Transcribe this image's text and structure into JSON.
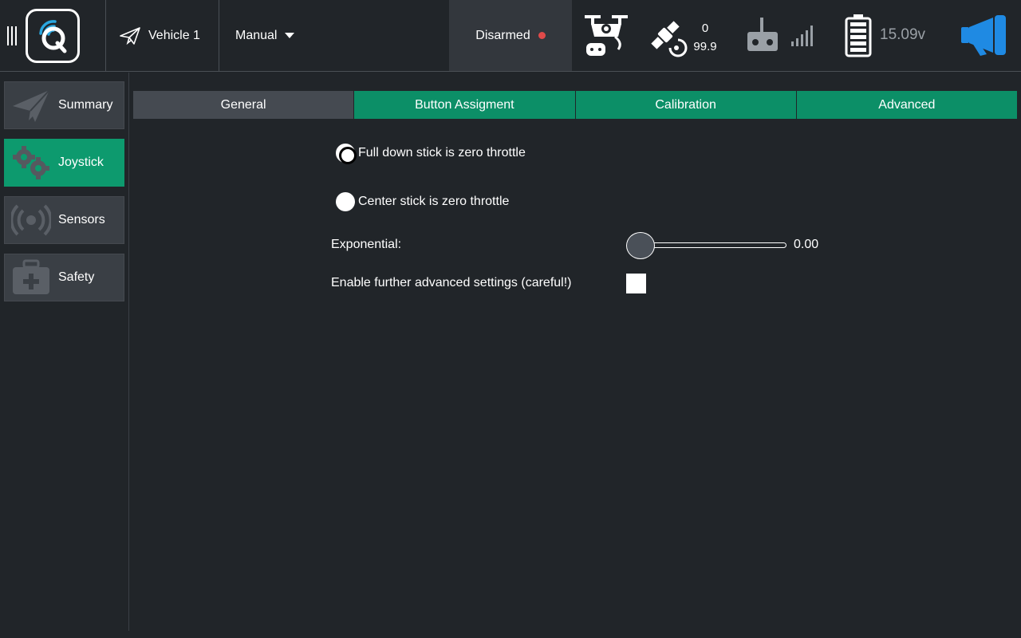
{
  "toolbar": {
    "vehicle_label": "Vehicle 1",
    "flight_mode": "Manual",
    "arm_status": "Disarmed",
    "gps_count": "0",
    "gps_hdop": "99.9",
    "battery_voltage": "15.09v",
    "icons": [
      "menu-handle-icon",
      "qgc-logo-icon",
      "paper-plane-icon",
      "dropdown-arrow-icon",
      "drone-icon",
      "satellite-icon",
      "rc-transmitter-icon",
      "signal-bars-icon",
      "battery-icon",
      "megaphone-icon"
    ],
    "colors": {
      "armed_dot": "#e04a4a",
      "megaphone": "#1f8ae3",
      "logo_accent": "#2aa7e0"
    }
  },
  "nav": {
    "items": [
      {
        "label": "Summary",
        "icon": "paper-plane-icon",
        "active": false
      },
      {
        "label": "Joystick",
        "icon": "gears-icon",
        "active": true
      },
      {
        "label": "Sensors",
        "icon": "sensor-waves-icon",
        "active": false
      },
      {
        "label": "Safety",
        "icon": "first-aid-kit-icon",
        "active": false
      }
    ]
  },
  "tabs": [
    {
      "label": "General",
      "active": true
    },
    {
      "label": "Button Assigment",
      "active": false
    },
    {
      "label": "Calibration",
      "active": false
    },
    {
      "label": "Advanced",
      "active": false
    }
  ],
  "general": {
    "throttle_options": [
      {
        "label": "Full down stick is zero throttle",
        "checked": true
      },
      {
        "label": "Center stick is zero throttle",
        "checked": false
      }
    ],
    "exponential_label": "Exponential:",
    "exponential_value": "0.00",
    "exponential_fraction": 0.0,
    "advanced_label": "Enable further advanced settings (careful!)",
    "advanced_checked": false
  },
  "theme": {
    "accent": "#0d9a6e",
    "background": "#212529",
    "nav_bg": "#3a3f45"
  }
}
